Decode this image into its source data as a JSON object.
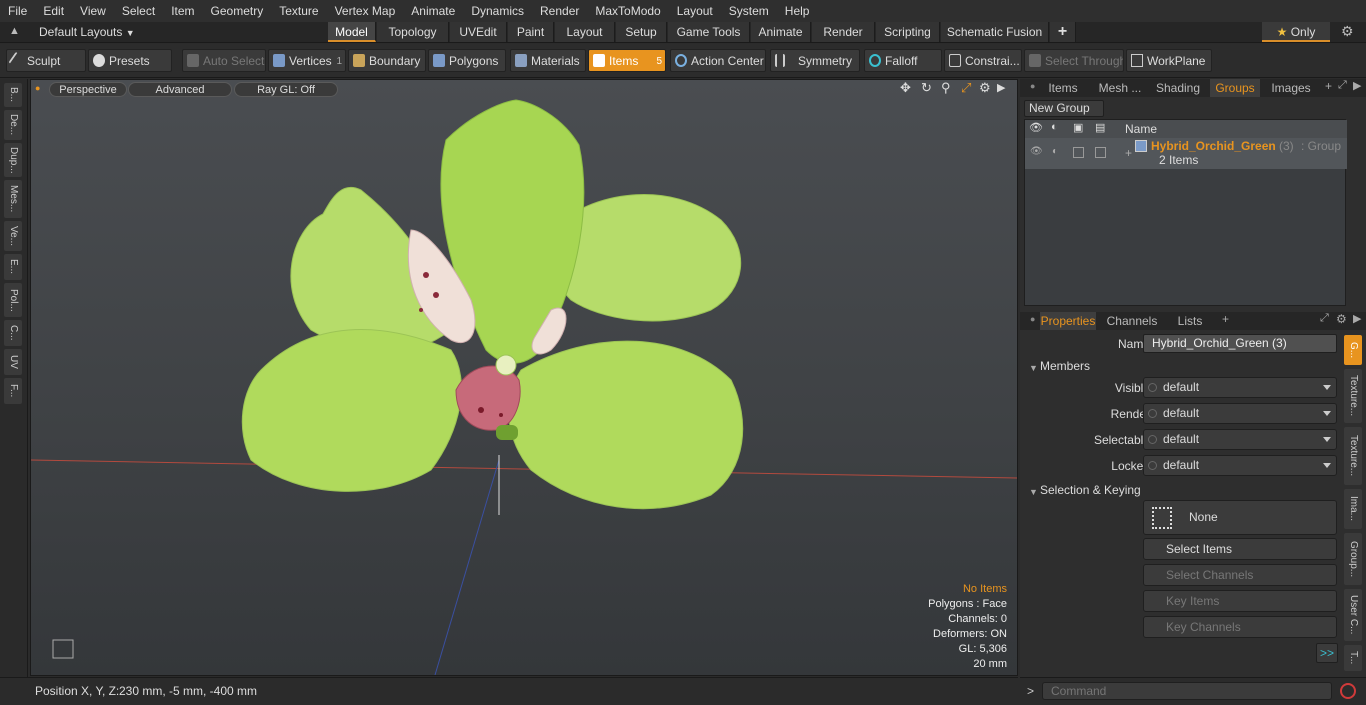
{
  "menu": [
    "File",
    "Edit",
    "View",
    "Select",
    "Item",
    "Geometry",
    "Texture",
    "Vertex Map",
    "Animate",
    "Dynamics",
    "Render",
    "MaxToModo",
    "Layout",
    "System",
    "Help"
  ],
  "layouts_label": "Default Layouts",
  "layout_tabs": [
    "Model",
    "Topology",
    "UVEdit",
    "Paint",
    "Layout",
    "Setup",
    "Game Tools",
    "Animate",
    "Render",
    "Scripting",
    "Schematic Fusion"
  ],
  "only_label": "Only",
  "toolbar": {
    "sculpt": "Sculpt",
    "presets": "Presets",
    "auto_select": "Auto Select",
    "vertices": "Vertices",
    "vertices_count": "1",
    "boundary": "Boundary",
    "polygons": "Polygons",
    "materials": "Materials",
    "items": "Items",
    "items_count": "5",
    "action_center": "Action Center",
    "symmetry": "Symmetry",
    "falloff": "Falloff",
    "constraints": "Constrai...",
    "select_through": "Select Through",
    "workplane": "WorkPlane"
  },
  "left_tabs": [
    "B...",
    "De...",
    "Dup...",
    "Mes...",
    "Ve...",
    "E...",
    "Pol...",
    "C...",
    "UV",
    "F..."
  ],
  "viewport": {
    "perspective": "Perspective",
    "advanced": "Advanced",
    "raygl": "Ray GL: Off",
    "info": {
      "no_items": "No Items",
      "polygons": "Polygons : Face",
      "channels": "Channels: 0",
      "deformers": "Deformers: ON",
      "gl": "GL: 5,306",
      "scale": "20 mm"
    }
  },
  "status": {
    "position_label": "Position X, Y, Z:",
    "position_value": "230 mm, -5 mm, -400 mm"
  },
  "groups_panel": {
    "tabs": [
      "Items",
      "Mesh ...",
      "Shading",
      "Groups",
      "Images"
    ],
    "new_group": "New Group",
    "name_header": "Name",
    "group_name": "Hybrid_Orchid_Green",
    "group_count": "(3)",
    "group_type": ": Group",
    "group_items": "2 Items"
  },
  "properties": {
    "tabs": [
      "Properties",
      "Channels",
      "Lists"
    ],
    "name_label": "Name",
    "name_value": "Hybrid_Orchid_Green (3)",
    "members": "Members",
    "visible_label": "Visible",
    "render_label": "Render",
    "selectable_label": "Selectable",
    "locked_label": "Locked",
    "default_value": "default",
    "selection_keying": "Selection & Keying",
    "none": "None",
    "select_items": "Select Items",
    "select_channels": "Select Channels",
    "key_items": "Key Items",
    "key_channels": "Key Channels",
    "more": ">>",
    "side_tabs": [
      "G...",
      "Texture...",
      "Texture...",
      "Ima...",
      "Group...",
      "User C...",
      "T..."
    ]
  },
  "command_placeholder": "Command",
  "colors": {
    "accent": "#e8941f",
    "petal": "#a6d44a"
  }
}
